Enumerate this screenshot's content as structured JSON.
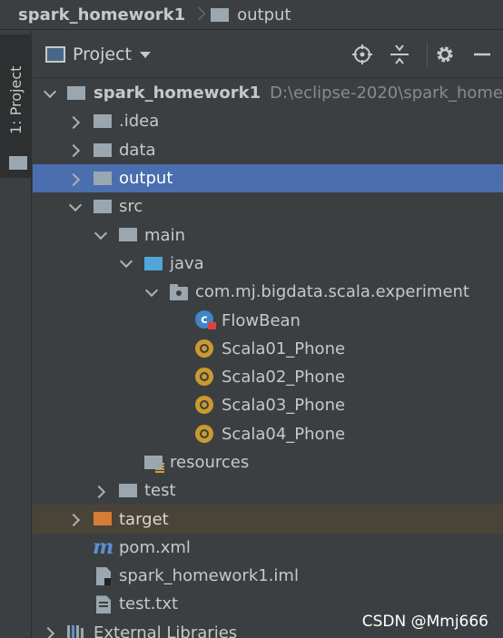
{
  "breadcrumb": {
    "root": "spark_homework1",
    "current": "output"
  },
  "tool_strip": {
    "tab_label": "1: Project"
  },
  "panel": {
    "title": "Project",
    "buttons": [
      "locate-icon",
      "collapse-all-icon",
      "gear-icon",
      "minimize-icon"
    ]
  },
  "tree": {
    "project": {
      "name": "spark_homework1",
      "path": "D:\\eclipse-2020\\spark_homew"
    },
    "idea": ".idea",
    "data": "data",
    "output": "output",
    "src": "src",
    "main": "main",
    "java": "java",
    "package": "com.mj.bigdata.scala.experiment",
    "classes": [
      "FlowBean",
      "Scala01_Phone",
      "Scala02_Phone",
      "Scala03_Phone",
      "Scala04_Phone"
    ],
    "resources": "resources",
    "test": "test",
    "target": "target",
    "pom": "pom.xml",
    "iml": "spark_homework1.iml",
    "txt": "test.txt",
    "libraries": "External Libraries"
  },
  "colors": {
    "background": "#3c3f41",
    "selection": "#4b6eaf",
    "excluded_row": "#4a4338",
    "folder": "#9aa7b0",
    "source_folder": "#4fa6d7",
    "excluded_folder": "#d67d35"
  },
  "watermark": "CSDN @Mmj666"
}
